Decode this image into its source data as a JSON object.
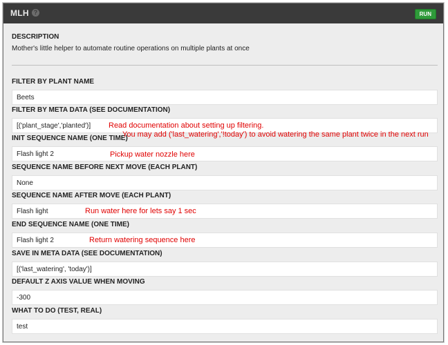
{
  "window": {
    "title": "MLH",
    "help_icon": "question-circle-icon",
    "run_label": "RUN",
    "accent_green": "#2f9b3a"
  },
  "description": {
    "heading": "DESCRIPTION",
    "text": "Mother's little helper to automate routine operations on multiple plants at once"
  },
  "fields": [
    {
      "label": "FILTER BY PLANT NAME",
      "value": "Beets"
    },
    {
      "label": "FILTER BY META DATA (SEE DOCUMENTATION)",
      "value": "[('plant_stage','planted')]"
    },
    {
      "label": "INIT SEQUENCE NAME (ONE TIME)",
      "value": "Flash light 2"
    },
    {
      "label": "SEQUENCE NAME BEFORE NEXT MOVE (EACH PLANT)",
      "value": "None"
    },
    {
      "label": "SEQUENCE NAME AFTER MOVE (EACH PLANT)",
      "value": "Flash light"
    },
    {
      "label": "END SEQUENCE NAME (ONE TIME)",
      "value": "Flash light 2"
    },
    {
      "label": "SAVE IN META DATA (SEE DOCUMENTATION)",
      "value": "[('last_watering', 'today')]"
    },
    {
      "label": "DEFAULT Z AXIS VALUE WHEN MOVING",
      "value": "-300"
    },
    {
      "label": "WHAT TO DO (TEST, REAL)",
      "value": "test"
    }
  ],
  "annotations": [
    "Read documentation about setting up filtering.",
    "You may add ('last_watering','!today') to avoid watering the same plant twice in the next run",
    "Pickup water nozzle here",
    "Run water here for lets say 1 sec",
    "Return watering sequence here"
  ],
  "annotation_color": "#e00000"
}
